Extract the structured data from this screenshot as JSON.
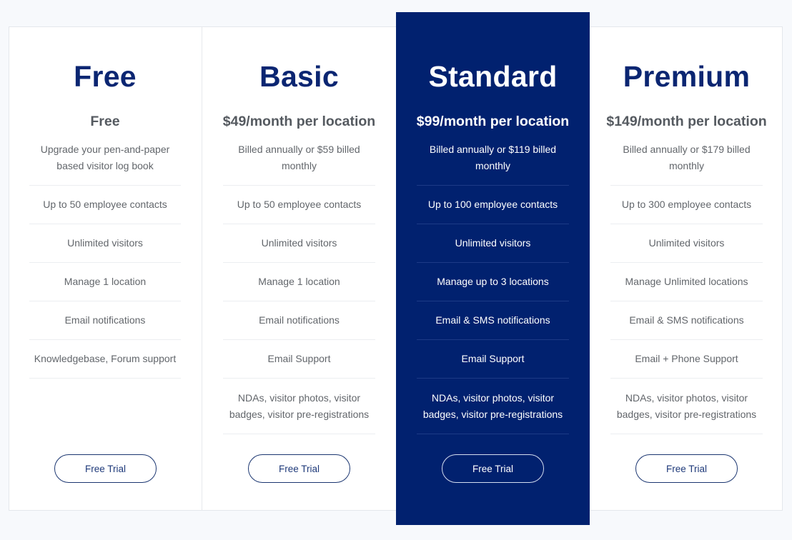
{
  "plans": [
    {
      "name": "Free",
      "price": "Free",
      "description": "Upgrade your pen-and-paper based visitor log book",
      "features": [
        "Up to 50 employee contacts",
        "Unlimited visitors",
        "Manage 1 location",
        "Email notifications",
        "Knowledgebase, Forum support"
      ],
      "button_label": "Free Trial",
      "featured": false
    },
    {
      "name": "Basic",
      "price": "$49/month per location",
      "description": "Billed annually or $59 billed monthly",
      "features": [
        "Up to 50 employee contacts",
        "Unlimited visitors",
        "Manage 1 location",
        "Email notifications",
        "Email Support",
        "NDAs, visitor photos, visitor badges, visitor pre-registrations"
      ],
      "button_label": "Free Trial",
      "featured": false
    },
    {
      "name": "Standard",
      "price": "$99/month per location",
      "description": "Billed annually or $119 billed monthly",
      "features": [
        "Up to 100 employee contacts",
        "Unlimited visitors",
        "Manage up to 3 locations",
        "Email & SMS notifications",
        "Email Support",
        "NDAs, visitor photos, visitor badges, visitor pre-registrations"
      ],
      "button_label": "Free Trial",
      "featured": true
    },
    {
      "name": "Premium",
      "price": "$149/month per location",
      "description": "Billed annually or $179 billed monthly",
      "features": [
        "Up to 300 employee contacts",
        "Unlimited visitors",
        "Manage Unlimited locations",
        "Email & SMS notifications",
        "Email + Phone Support",
        "NDAs, visitor photos, visitor badges, visitor pre-registrations"
      ],
      "button_label": "Free Trial",
      "featured": false
    }
  ],
  "colors": {
    "accent": "#01216f",
    "title": "#0b2672",
    "text": "#62666b",
    "background": "#f7f9fc"
  }
}
